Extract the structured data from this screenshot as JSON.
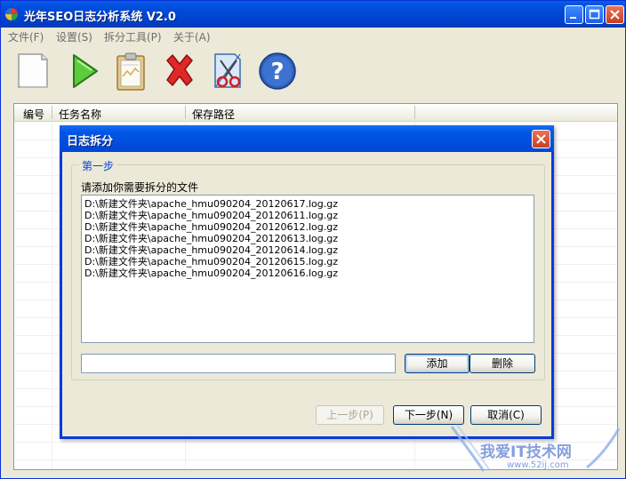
{
  "window": {
    "title": "光年SEO日志分析系统 V2.0"
  },
  "menu": {
    "items": [
      "文件(F)",
      "设置(S)",
      "拆分工具(P)",
      "关于(A)"
    ]
  },
  "toolbar": {
    "icons": [
      "new-file-icon",
      "play-icon",
      "clipboard-icon",
      "delete-icon",
      "split-icon",
      "help-icon"
    ]
  },
  "list": {
    "columns": [
      "编号",
      "任务名称",
      "保存路径"
    ]
  },
  "dialog": {
    "title": "日志拆分",
    "group_title": "第一步",
    "instruction": "请添加你需要拆分的文件",
    "files": [
      "D:\\新建文件夹\\apache_hmu090204_20120617.log.gz",
      "D:\\新建文件夹\\apache_hmu090204_20120611.log.gz",
      "D:\\新建文件夹\\apache_hmu090204_20120612.log.gz",
      "D:\\新建文件夹\\apache_hmu090204_20120613.log.gz",
      "D:\\新建文件夹\\apache_hmu090204_20120614.log.gz",
      "D:\\新建文件夹\\apache_hmu090204_20120615.log.gz",
      "D:\\新建文件夹\\apache_hmu090204_20120616.log.gz"
    ],
    "path_value": "",
    "add_label": "添加",
    "delete_label": "删除",
    "prev_label": "上一步(P)",
    "next_label": "下一步(N)",
    "cancel_label": "取消(C)"
  },
  "watermark": {
    "text": "我爱IT技术网",
    "url": "www.52ij.com"
  },
  "colors": {
    "title_blue": "#0050DE",
    "accent_blue": "#0046D5",
    "close_red": "#C6401E",
    "face": "#ECE9D8"
  }
}
